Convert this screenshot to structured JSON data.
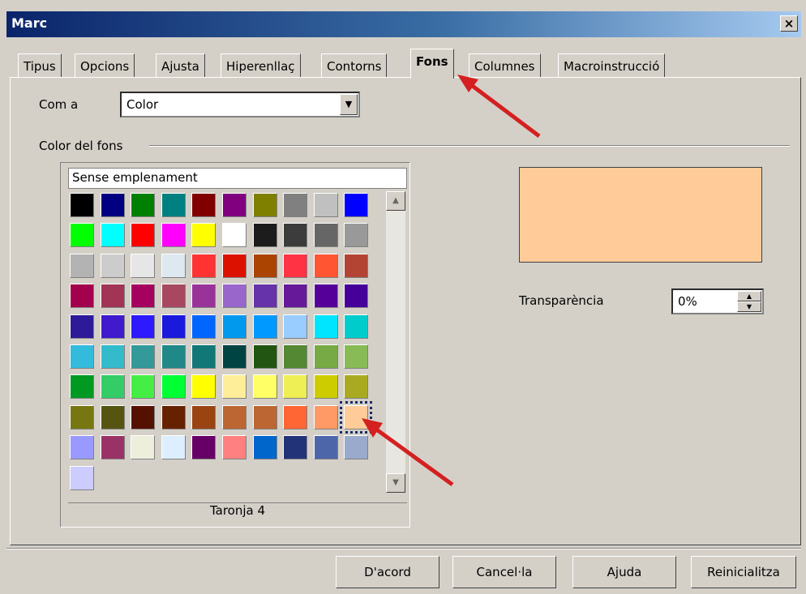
{
  "window": {
    "title": "Marc",
    "close_glyph": "×"
  },
  "tabs": [
    "Tipus",
    "Opcions",
    "Ajusta",
    "Hiperenllaç",
    "Contorns",
    "Fons",
    "Columnes",
    "Macroinstrucció"
  ],
  "active_tab": "Fons",
  "as": {
    "label": "Com a",
    "value": "Color"
  },
  "group": {
    "label": "Color del fons"
  },
  "palette": {
    "no_fill": "Sense emplenament",
    "selected_name": "Taronja 4",
    "selected_index": 79,
    "colors": [
      "#000000",
      "#000080",
      "#008000",
      "#008080",
      "#800000",
      "#800080",
      "#808000",
      "#808080",
      "#c0c0c0",
      "#0000ff",
      "#00ff00",
      "#00ffff",
      "#ff0000",
      "#ff00ff",
      "#ffff00",
      "#ffffff",
      "#1c1c1c",
      "#3c3c3c",
      "#666666",
      "#999999",
      "#b3b3b3",
      "#cccccc",
      "#e6e6e6",
      "#dde8f0",
      "#ff3333",
      "#dd1100",
      "#aa4400",
      "#ff3344",
      "#ff5533",
      "#b34433",
      "#a3004e",
      "#a23455",
      "#a60060",
      "#a84860",
      "#993399",
      "#9966cc",
      "#6633aa",
      "#661a99",
      "#550099",
      "#440099",
      "#2d1a99",
      "#401acc",
      "#2d1aff",
      "#1a1add",
      "#0066ff",
      "#0099ee",
      "#0099ff",
      "#99ccff",
      "#00e5ff",
      "#00cccc",
      "#33bbdd",
      "#33bbcc",
      "#339999",
      "#218888",
      "#117777",
      "#004444",
      "#225511",
      "#558833",
      "#77aa44",
      "#88bb55",
      "#009922",
      "#33cc66",
      "#44ee44",
      "#00ff33",
      "#ffff00",
      "#ffee99",
      "#ffff66",
      "#eeee55",
      "#cccc00",
      "#aaaa22",
      "#777711",
      "#555511",
      "#551100",
      "#662200",
      "#994411",
      "#bb6633",
      "#bb6633",
      "#ff6633",
      "#ff9966",
      "#ffcc99",
      "#9999ff",
      "#993366",
      "#eeeedd",
      "#ddeeff",
      "#660066",
      "#ff8080",
      "#0066cc",
      "#223377",
      "#4d66aa",
      "#99aacc",
      "#ccccff"
    ]
  },
  "preview": {
    "color": "#ffcc99"
  },
  "transparency": {
    "label": "Transparència",
    "value": "0%"
  },
  "buttons": {
    "ok": "D'acord",
    "cancel": "Cancel·la",
    "help": "Ajuda",
    "reset": "Reinicialitza"
  },
  "icons": {
    "dropdown": "▼",
    "scroll_up": "▲",
    "scroll_down": "▼",
    "spin_up": "▲",
    "spin_down": "▼"
  }
}
